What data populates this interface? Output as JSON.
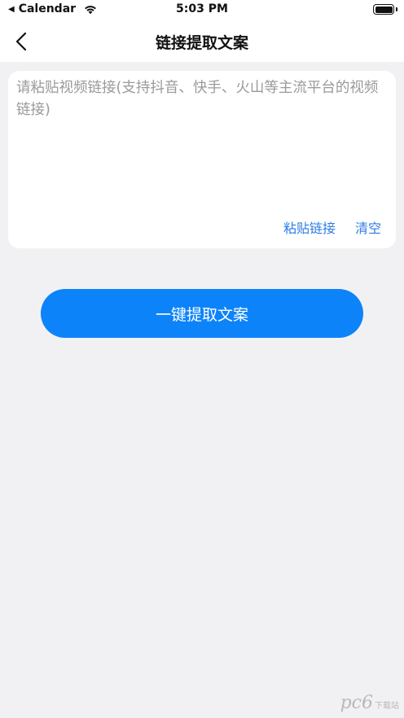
{
  "status_bar": {
    "back_app": "Calendar",
    "time": "5:03 PM",
    "battery_level": 1.0
  },
  "nav": {
    "title": "链接提取文案"
  },
  "input": {
    "placeholder": "请粘贴视频链接(支持抖音、快手、火山等主流平台的视频链接)",
    "value": ""
  },
  "actions": {
    "paste_label": "粘贴链接",
    "clear_label": "清空"
  },
  "primary_button": {
    "label": "一键提取文案"
  },
  "watermark": {
    "main": "pc6",
    "sub": "下载站"
  },
  "colors": {
    "accent": "#0d83fa",
    "link": "#2f7be6",
    "background": "#f1f1f3"
  }
}
